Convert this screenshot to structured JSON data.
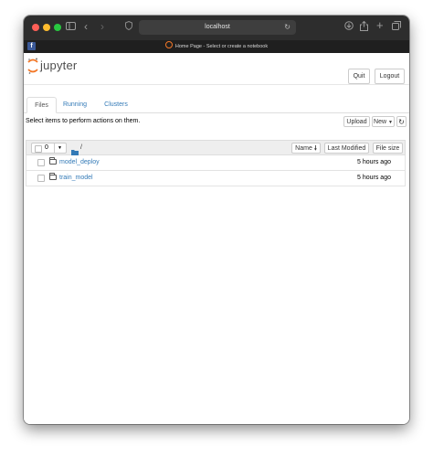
{
  "browser": {
    "url": "localhost",
    "tab_title": "Home Page - Select or create a notebook",
    "favicon_letter": "f"
  },
  "header": {
    "logo_text": "jupyter",
    "quit_label": "Quit",
    "logout_label": "Logout"
  },
  "tabs": [
    "Files",
    "Running",
    "Clusters"
  ],
  "toolbar": {
    "message": "Select items to perform actions on them.",
    "upload_label": "Upload",
    "new_label": "New",
    "refresh_icon": "refresh-icon"
  },
  "list_header": {
    "selected_count": "0",
    "path": "/",
    "sort_name": "Name",
    "sort_modified": "Last Modified",
    "sort_size": "File size"
  },
  "files": [
    {
      "name": "model_deploy",
      "modified": "5 hours ago"
    },
    {
      "name": "train_model",
      "modified": "5 hours ago"
    }
  ],
  "colors": {
    "link": "#337ab7",
    "jupyter_orange": "#f37726",
    "close": "#ff5f57",
    "minimize": "#febc2e",
    "zoom": "#28c840"
  }
}
